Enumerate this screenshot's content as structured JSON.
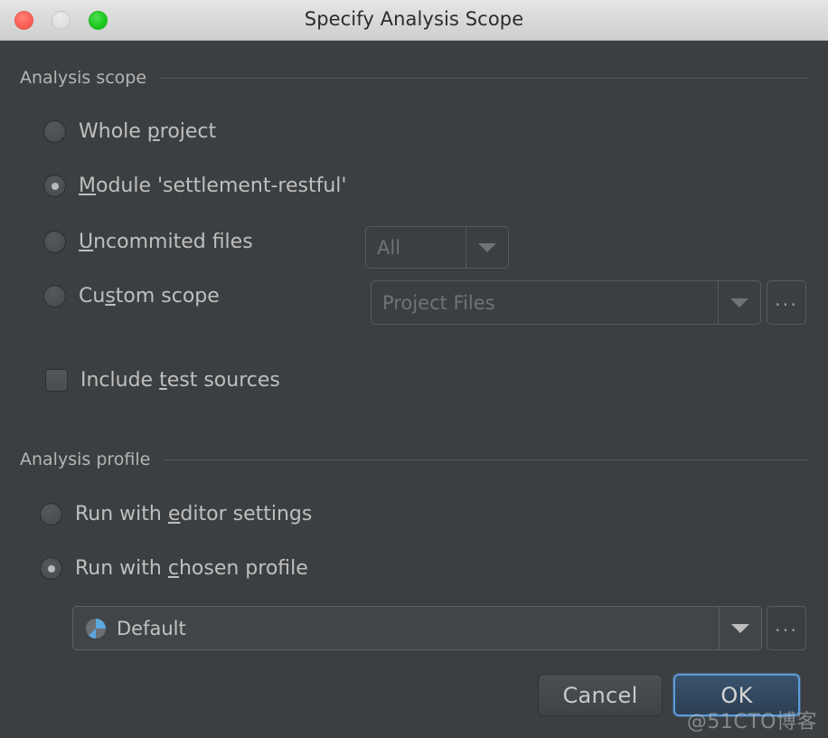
{
  "window": {
    "title": "Specify Analysis Scope",
    "controls": {
      "close_label": "close",
      "minimize_label": "minimize",
      "maximize_label": "maximize"
    }
  },
  "colors": {
    "dialog_bg": "#3c3f41",
    "titlebar_bg": "#d8d8d8",
    "text": "#bfbfbf",
    "muted_text": "#6f7376",
    "separator": "#56595b",
    "accent_focus_ring": "#5b9bd9",
    "default_button_fill": "#32485f",
    "traffic_close": "#fc6158",
    "traffic_minimize": "#e0e0e0",
    "traffic_maximize": "#1ec81f",
    "pie_icon_grey": "#6b6f71",
    "pie_icon_blue": "#5ca7de"
  },
  "scope_group": {
    "title": "Analysis scope",
    "options": [
      {
        "id": "whole-project",
        "label_before": "Whole ",
        "mnemonic": "p",
        "label_after": "roject",
        "selected": false
      },
      {
        "id": "module",
        "label_before": "",
        "mnemonic": "M",
        "label_after": "odule 'settlement-restful'",
        "selected": true
      },
      {
        "id": "uncommited-files",
        "label_before": "",
        "mnemonic": "U",
        "label_after": "ncommited files",
        "selected": false
      },
      {
        "id": "custom-scope",
        "label_before": "Cu",
        "mnemonic": "s",
        "label_after": "tom scope",
        "selected": false
      }
    ],
    "uncommited_combo": {
      "value": "All",
      "enabled": false,
      "arrow_icon": "chevron-down-icon"
    },
    "custom_scope_combo": {
      "value": "Project Files",
      "enabled": false,
      "arrow_icon": "chevron-down-icon"
    },
    "custom_scope_browse": {
      "label": "...",
      "icon": "ellipsis-icon"
    },
    "include_test_sources": {
      "label_before": "Include ",
      "mnemonic": "t",
      "label_after": "est sources",
      "checked": false
    }
  },
  "profile_group": {
    "title": "Analysis profile",
    "options": [
      {
        "id": "editor-settings",
        "label_before": "Run with ",
        "mnemonic": "e",
        "label_after": "ditor settings",
        "selected": false
      },
      {
        "id": "chosen-profile",
        "label_before": "Run with ",
        "mnemonic": "c",
        "label_after": "hosen profile",
        "selected": true
      }
    ],
    "profile_combo": {
      "value": "Default",
      "enabled": true,
      "icon": "profile-pie-icon",
      "arrow_icon": "chevron-down-icon"
    },
    "profile_browse": {
      "label": "...",
      "icon": "ellipsis-icon"
    }
  },
  "footer": {
    "cancel_label": "Cancel",
    "ok_label": "OK",
    "default_button": "OK"
  },
  "watermark": {
    "text": "@51CTO博客"
  }
}
